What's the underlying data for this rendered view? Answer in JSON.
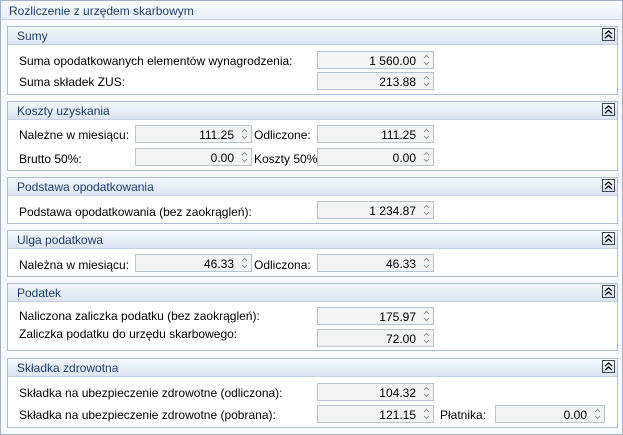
{
  "window": {
    "title": "Rozliczenie z urzędem skarbowym"
  },
  "sections": {
    "sumy": {
      "title": "Sumy",
      "wynagrodzenia_label": "Suma opodatkowanych elementów wynagrodzenia:",
      "wynagrodzenia_value": "1 560.00",
      "zus_label": "Suma składek ZUS:",
      "zus_value": "213.88"
    },
    "koszty": {
      "title": "Koszty uzyskania",
      "nalezne_label": "Należne w miesiącu:",
      "nalezne_value": "111.25",
      "odliczone_label": "Odliczone:",
      "odliczone_value": "111.25",
      "brutto_label": "Brutto 50%:",
      "brutto_value": "0.00",
      "koszty50_label": "Koszty 50%:",
      "koszty50_value": "0.00"
    },
    "podstawa": {
      "title": "Podstawa opodatkowania",
      "label": "Podstawa opodatkowania (bez zaokrągleń):",
      "value": "1 234.87"
    },
    "ulga": {
      "title": "Ulga podatkowa",
      "nalezna_label": "Należna w miesiącu:",
      "nalezna_value": "46.33",
      "odliczona_label": "Odliczona:",
      "odliczona_value": "46.33"
    },
    "podatek": {
      "title": "Podatek",
      "naliczona_label": "Naliczona zaliczka podatku (bez zaokrągleń):",
      "naliczona_value": "175.97",
      "zaliczka_label": "Zaliczka podatku do urzędu skarbowego:",
      "zaliczka_value": "72.00"
    },
    "zdrowotna": {
      "title": "Składka zdrowotna",
      "odliczona_label": "Składka na ubezpieczenie zdrowotne (odliczona):",
      "odliczona_value": "104.32",
      "pobrana_label": "Składka na ubezpieczenie zdrowotne (pobrana):",
      "pobrana_value": "121.15",
      "platnika_label": "Płatnika:",
      "platnika_value": "0.00"
    }
  },
  "icons": {
    "collapse": "double-chevron-up-icon",
    "spinner": "spin-up-down-icon"
  },
  "colors": {
    "section_title": "#1e3f6e",
    "border": "#aebdd2",
    "field_bg": "#f3f3f3"
  }
}
